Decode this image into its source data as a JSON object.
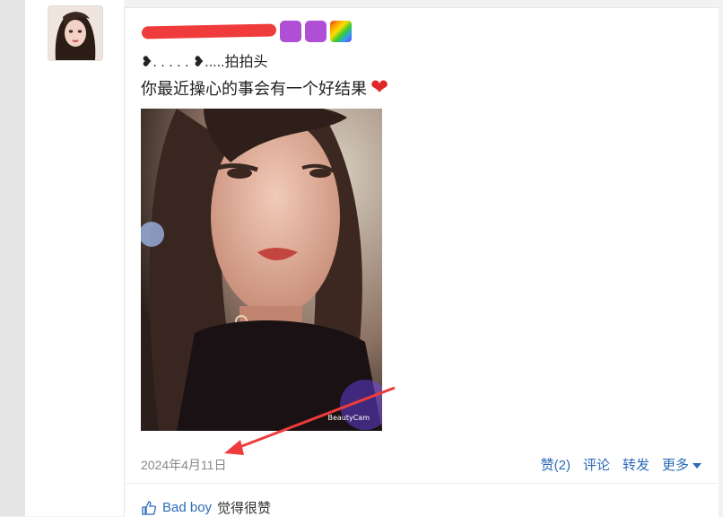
{
  "post": {
    "line1": "❥. . . . . ❥.....拍拍头",
    "line2": "你最近操心的事会有一个好结果",
    "photo_watermark": "BeautyCam",
    "date": "2024年4月11日"
  },
  "actions": {
    "like": "赞(2)",
    "comment": "评论",
    "share": "转发",
    "more": "更多"
  },
  "likes": {
    "user": "Bad boy",
    "text": "觉得很赞"
  },
  "colors": {
    "link": "#2a6ab5",
    "annotation_red": "#ef3b3b"
  },
  "icons": [
    "heart-emoji-icon",
    "thumbs-up-icon",
    "chevron-down-icon",
    "rainbow-emoji-icon"
  ]
}
